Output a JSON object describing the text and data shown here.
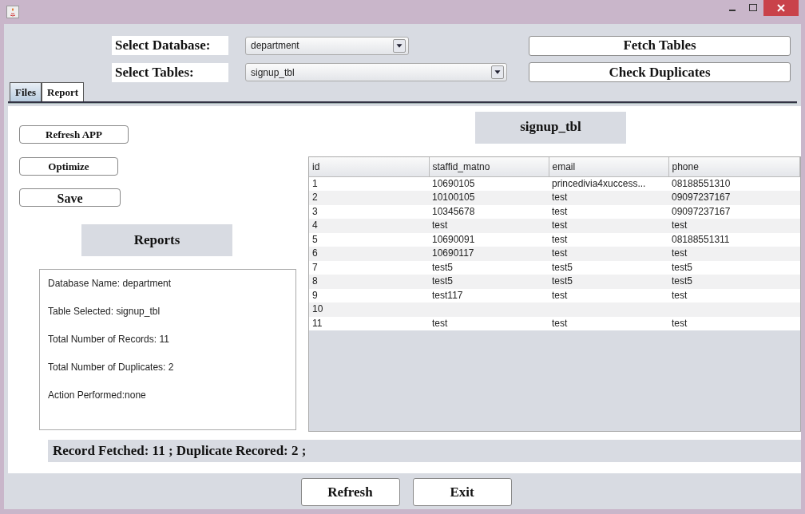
{
  "database": {
    "label": "Select Database:",
    "value": "department"
  },
  "tables": {
    "label": "Select Tables:",
    "value": "signup_tbl"
  },
  "top_buttons": [
    "Fetch Tables",
    "Check Duplicates"
  ],
  "tabs": [
    {
      "label": "Files",
      "selected": true
    },
    {
      "label": "Report",
      "selected": false
    }
  ],
  "side_buttons": [
    "Refresh APP",
    "Optimize",
    "Save"
  ],
  "reports_heading": "Reports",
  "report_lines": [
    "Database Name: department",
    "Table Selected: signup_tbl",
    "Total Number of Records: 11",
    "Total Number of Duplicates: 2",
    "Action Performed:none"
  ],
  "table_heading": "signup_tbl",
  "table": {
    "columns": [
      "id",
      "staffid_matno",
      "email",
      "phone"
    ],
    "rows": [
      [
        "1",
        "10690105",
        "princedivia4xuccess...",
        "08188551310"
      ],
      [
        "2",
        "10100105",
        "test",
        "09097237167"
      ],
      [
        "3",
        "10345678",
        "test",
        "09097237167"
      ],
      [
        "4",
        "test",
        "test",
        "test"
      ],
      [
        "5",
        "10690091",
        "test",
        "08188551311"
      ],
      [
        "6",
        "10690117",
        "test",
        "test"
      ],
      [
        "7",
        "test5",
        "test5",
        "test5"
      ],
      [
        "8",
        "test5",
        "test5",
        "test5"
      ],
      [
        "9",
        "test117",
        "test",
        "test"
      ],
      [
        "10",
        "",
        "",
        ""
      ],
      [
        "11",
        "test",
        "test",
        "test"
      ]
    ]
  },
  "status_bar": "Record Fetched: 11 ; Duplicate Recored: 2 ;",
  "bottom_buttons": [
    "Refresh",
    "Exit"
  ]
}
